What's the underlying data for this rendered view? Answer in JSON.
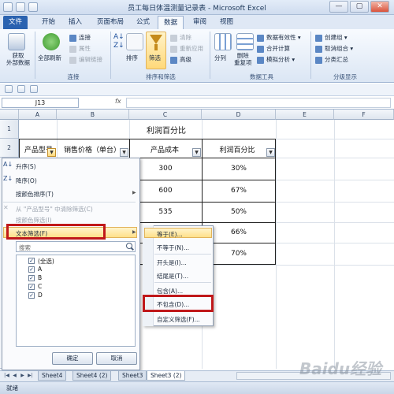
{
  "window": {
    "title": "员工每日体温测量记录表 - Microsoft Excel",
    "controls": [
      "—",
      "▢",
      "✕"
    ]
  },
  "ribbon": {
    "tabs": [
      "文件",
      "开始",
      "插入",
      "页面布局",
      "公式",
      "数据",
      "审阅",
      "视图"
    ],
    "active_tab": "数据",
    "groups": {
      "get_external": {
        "label": "获取\n外部数据"
      },
      "connections": {
        "label": "连接",
        "refresh_all": "全部刷新",
        "items": [
          "连接",
          "属性",
          "编辑链接"
        ]
      },
      "sort_filter": {
        "label": "排序和筛选",
        "sort": "排序",
        "filter": "筛选",
        "items": [
          "清除",
          "重新应用",
          "高级"
        ]
      },
      "data_tools": {
        "label": "数据工具",
        "split": "分列",
        "remove_dup": "删除\n重复项",
        "items": [
          "数据有效性",
          "合并计算",
          "模拟分析"
        ]
      },
      "outline": {
        "label": "分级显示",
        "items": [
          "创建组",
          "取消组合",
          "分类汇总"
        ]
      }
    }
  },
  "formula_bar": {
    "name_box": "J13",
    "fx": "fx",
    "formula": ""
  },
  "grid": {
    "columns": [
      "A",
      "B",
      "C",
      "D",
      "E",
      "F"
    ],
    "rows": [
      "1",
      "2"
    ],
    "title": "利润百分比",
    "headers": [
      "产品型号",
      "销售价格（单台）",
      "产品成本",
      "利润百分比"
    ],
    "cost": [
      "300",
      "600",
      "535",
      "",
      ""
    ],
    "profit_pct": [
      "30%",
      "67%",
      "50%",
      "66%",
      "70%"
    ]
  },
  "filter_menu": {
    "sort_asc": "升序(S)",
    "sort_desc": "降序(O)",
    "sort_color": "按颜色排序(T)",
    "clear_filter": "从 \"产品型号\" 中清除筛选(C)",
    "filter_color": "按颜色筛选(I)",
    "text_filter": "文本筛选(F)",
    "search_placeholder": "搜索",
    "values": [
      "(全选)",
      "A",
      "B",
      "C",
      "D"
    ],
    "ok": "确定",
    "cancel": "取消"
  },
  "text_filter_menu": {
    "items": [
      "等于(E)...",
      "不等于(N)...",
      "开头是(I)...",
      "结尾是(T)...",
      "包含(A)...",
      "不包含(D)...",
      "自定义筛选(F)..."
    ]
  },
  "sheet_tabs": [
    "Sheet4",
    "Sheet4 (2)",
    "Sheet3",
    "Sheet3 (2)"
  ],
  "active_sheet": "Sheet3 (2)",
  "status": "就绪",
  "watermark": "Baidu经验",
  "colors": {
    "accent": "#2a62b0",
    "highlight": "#ffe08a",
    "annotation": "#c0181a"
  }
}
